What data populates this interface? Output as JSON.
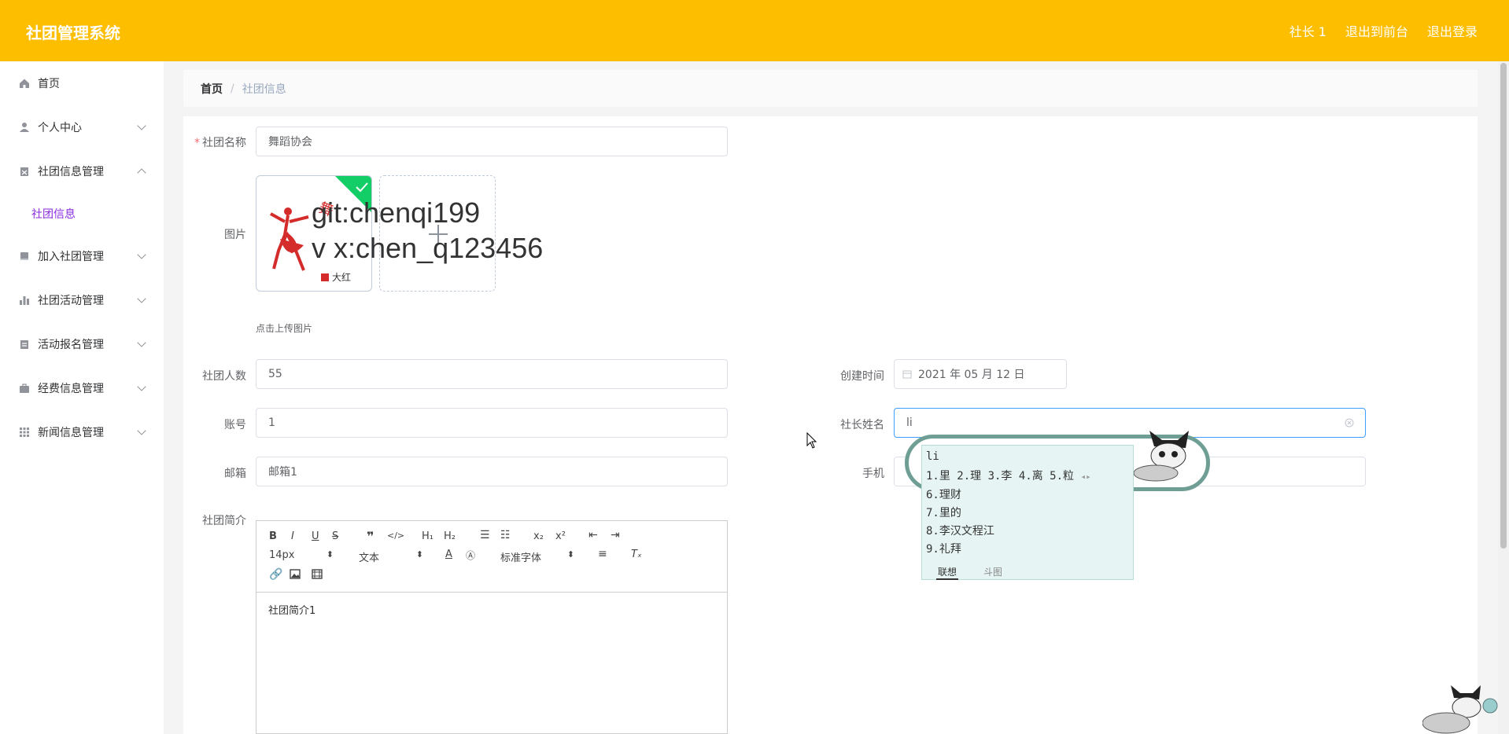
{
  "app": {
    "title": "社团管理系统"
  },
  "header": {
    "links": [
      "社长 1",
      "退出到前台",
      "退出登录"
    ]
  },
  "sidebar": {
    "items": [
      {
        "label": "首页",
        "icon": "home-icon"
      },
      {
        "label": "个人中心",
        "icon": "user-icon"
      },
      {
        "label": "社团信息管理",
        "icon": "clipboard-icon",
        "expanded": true,
        "children": [
          "社团信息"
        ]
      },
      {
        "label": "加入社团管理",
        "icon": "book-icon"
      },
      {
        "label": "社团活动管理",
        "icon": "bar-chart-icon"
      },
      {
        "label": "活动报名管理",
        "icon": "list-icon"
      },
      {
        "label": "经费信息管理",
        "icon": "briefcase-icon"
      },
      {
        "label": "新闻信息管理",
        "icon": "grid-icon"
      }
    ]
  },
  "breadcrumb": {
    "home": "首页",
    "current": "社团信息"
  },
  "form": {
    "club_name_label": "社团名称",
    "club_name_value": "舞蹈协会",
    "image_label": "图片",
    "image_caption": "大红",
    "upload_tip": "点击上传图片",
    "member_count_label": "社团人数",
    "member_count_value": "55",
    "create_time_label": "创建时间",
    "create_time_value": "2021 年 05 月 12 日",
    "account_label": "账号",
    "account_value": "1",
    "president_label": "社长姓名",
    "president_value": "li",
    "email_label": "邮箱",
    "email_value": "邮箱1",
    "phone_label": "手机",
    "intro_label": "社团简介",
    "intro_value": "社团简介1"
  },
  "editor": {
    "size": "14px",
    "format": "文本",
    "font": "标准字体"
  },
  "ime": {
    "composition": "li",
    "candidates": "1.里  2.理  3.李  4.离  5.粒",
    "list": [
      "6.理财",
      "7.里的",
      "8.李汉文程江",
      "9.礼拜"
    ],
    "tab_1": "联想",
    "tab_2": "斗图"
  },
  "watermark": {
    "line1": "git:chenqi199",
    "line2": "v x:chen_q123456"
  },
  "colors": {
    "header": "#fdbe00",
    "active_sub": "#8a2be2",
    "required": "#f56c6c"
  }
}
